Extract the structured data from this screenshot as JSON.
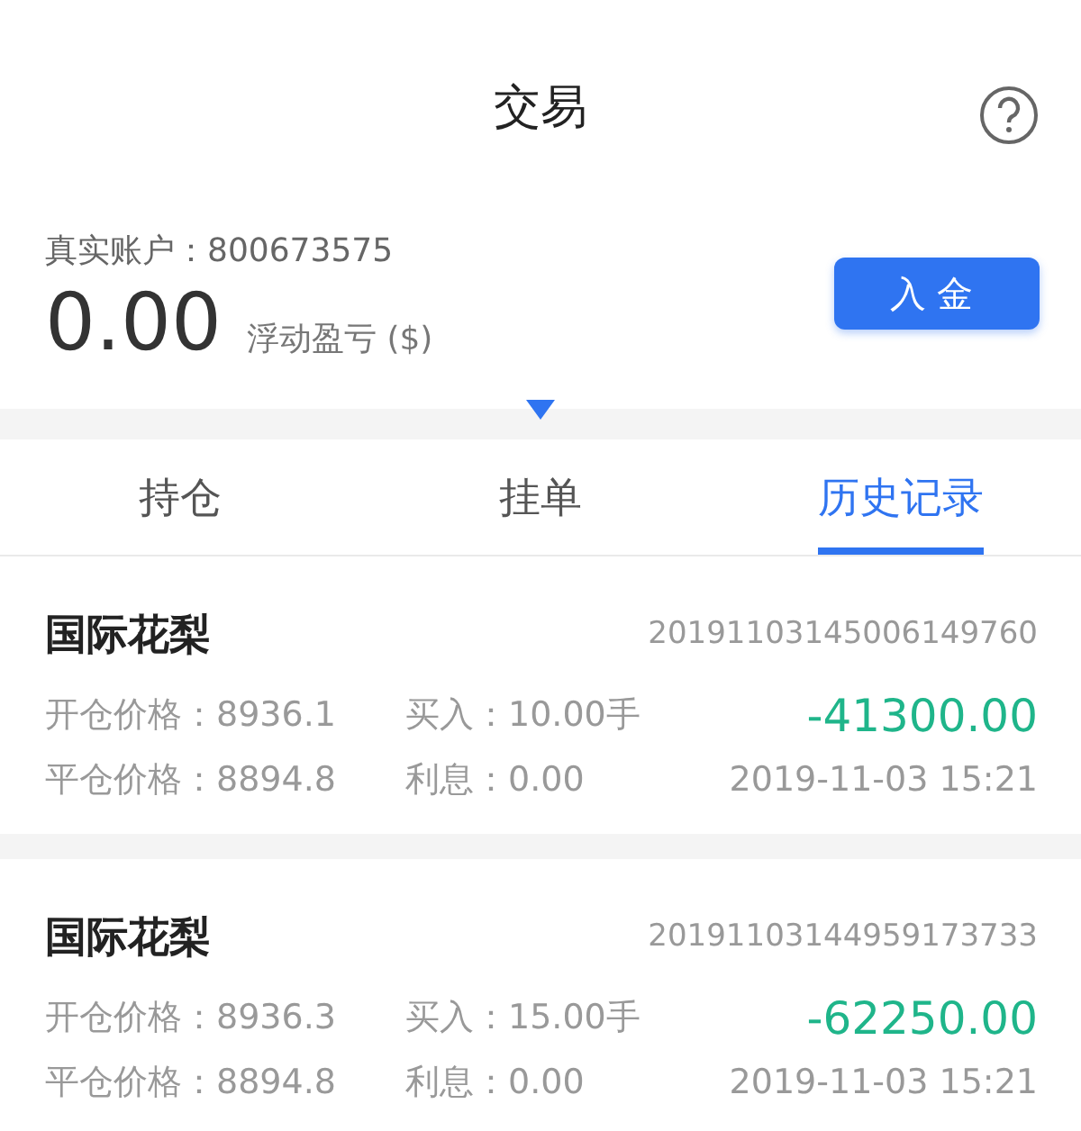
{
  "header": {
    "title": "交易"
  },
  "account": {
    "label": "真实账户：800673575",
    "amount": "0.00",
    "amount_label": "浮动盈亏 ($)",
    "deposit_button": "入金"
  },
  "tabs": [
    {
      "label": "持仓",
      "selected": false
    },
    {
      "label": "挂单",
      "selected": false
    },
    {
      "label": "历史记录",
      "selected": true
    }
  ],
  "orders": [
    {
      "name": "国际花梨",
      "order_no": "20191103145006149760",
      "open_price": "开仓价格：8936.1",
      "direction": "买入：10.00手",
      "profit": "-41300.00",
      "close_price": "平仓价格：8894.8",
      "interest": "利息：0.00",
      "time": "2019-11-03 15:21"
    },
    {
      "name": "国际花梨",
      "order_no": "20191103144959173733",
      "open_price": "开仓价格：8936.3",
      "direction": "买入：15.00手",
      "profit": "-62250.00",
      "close_price": "平仓价格：8894.8",
      "interest": "利息：0.00",
      "time": "2019-11-03 15:21"
    }
  ]
}
